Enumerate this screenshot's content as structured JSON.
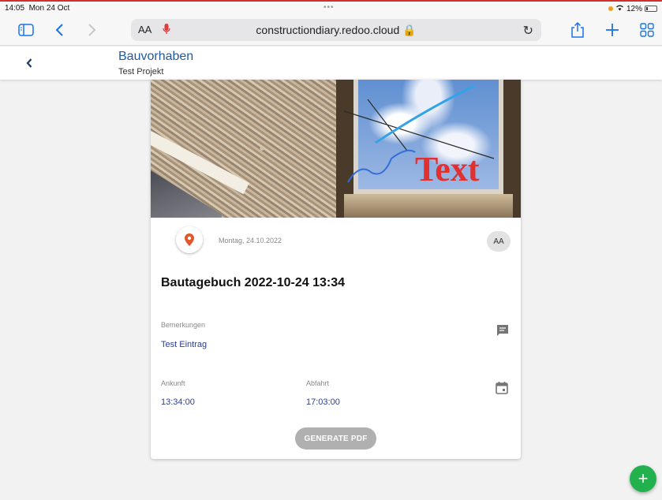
{
  "status": {
    "time": "14:05",
    "date": "Mon 24 Oct",
    "battery": "12%",
    "dots": "•••"
  },
  "browser": {
    "text_size_label": "AA",
    "url": "constructiondiary.redoo.cloud 🔒",
    "reload_icon": "↻"
  },
  "header": {
    "back_label": "‹",
    "title": "Bauvorhaben",
    "subtitle": "Test Projekt"
  },
  "entry": {
    "photo_overlay_text": "Text",
    "date": "Montag, 24.10.2022",
    "avatar_initials": "AA",
    "title": "Bautagebuch 2022-10-24 13:34",
    "remarks_label": "Bemerkungen",
    "remarks_value": "Test Eintrag",
    "arrival_label": "Ankunft",
    "arrival_value": "13:34:00",
    "departure_label": "Abfahrt",
    "departure_value": "17:03:00",
    "pdf_button": "GENERATE PDF"
  },
  "fab": {
    "label": "+"
  },
  "colors": {
    "accent": "#1f5aa0",
    "fab": "#23b14d",
    "pin": "#e2572a",
    "status_bar_line": "#d32f2f"
  }
}
